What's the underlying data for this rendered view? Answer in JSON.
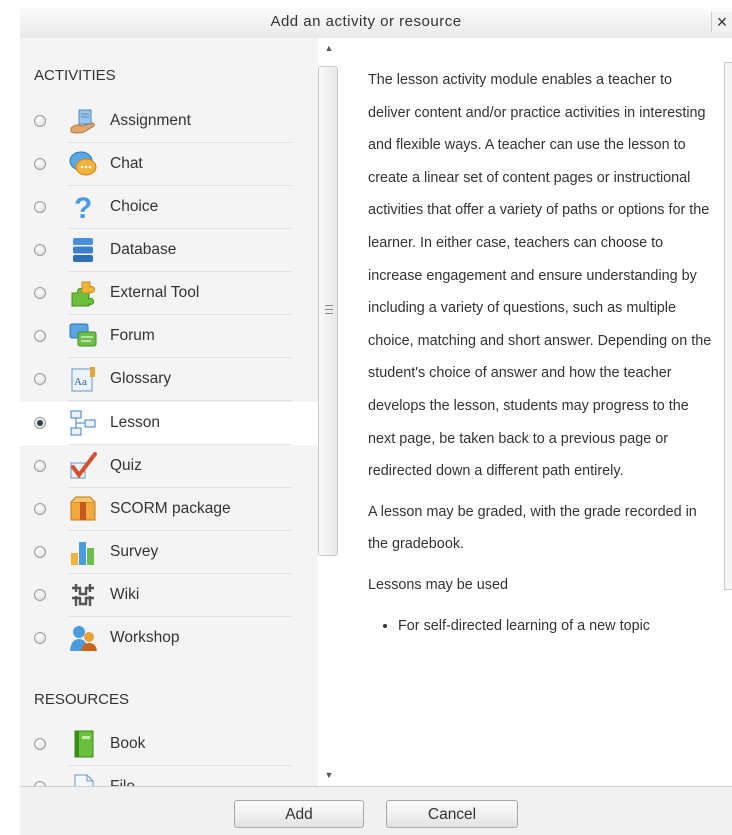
{
  "dialog": {
    "title": "Add an activity or resource",
    "close_label": "×"
  },
  "activities": {
    "heading": "ACTIVITIES",
    "items": [
      {
        "label": "Assignment",
        "icon": "assignment-icon",
        "selected": false
      },
      {
        "label": "Chat",
        "icon": "chat-icon",
        "selected": false
      },
      {
        "label": "Choice",
        "icon": "choice-icon",
        "selected": false
      },
      {
        "label": "Database",
        "icon": "database-icon",
        "selected": false
      },
      {
        "label": "External Tool",
        "icon": "external-tool-icon",
        "selected": false
      },
      {
        "label": "Forum",
        "icon": "forum-icon",
        "selected": false
      },
      {
        "label": "Glossary",
        "icon": "glossary-icon",
        "selected": false
      },
      {
        "label": "Lesson",
        "icon": "lesson-icon",
        "selected": true
      },
      {
        "label": "Quiz",
        "icon": "quiz-icon",
        "selected": false
      },
      {
        "label": "SCORM package",
        "icon": "scorm-icon",
        "selected": false
      },
      {
        "label": "Survey",
        "icon": "survey-icon",
        "selected": false
      },
      {
        "label": "Wiki",
        "icon": "wiki-icon",
        "selected": false
      },
      {
        "label": "Workshop",
        "icon": "workshop-icon",
        "selected": false
      }
    ]
  },
  "resources": {
    "heading": "RESOURCES",
    "items": [
      {
        "label": "Book",
        "icon": "book-icon",
        "selected": false
      },
      {
        "label": "File",
        "icon": "file-icon",
        "selected": false
      }
    ]
  },
  "description": {
    "paragraph1": "The lesson activity module enables a teacher to deliver content and/or practice activities in interesting and flexible ways. A teacher can use the lesson to create a linear set of content pages or instructional activities that offer a variety of paths or options for the learner. In either case, teachers can choose to increase engagement and ensure understanding by including a variety of questions, such as multiple choice, matching and short answer. Depending on the student's choice of answer and how the teacher develops the lesson, students may progress to the next page, be taken back to a previous page or redirected down a different path entirely.",
    "paragraph2": "A lesson may be graded, with the grade recorded in the gradebook.",
    "paragraph3": "Lessons may be used",
    "bullets": [
      "For self-directed learning of a new topic"
    ]
  },
  "footer": {
    "add_label": "Add",
    "cancel_label": "Cancel"
  },
  "colors": {
    "left_pane_bg": "#f4f4f4",
    "selected_row_bg": "#ffffff",
    "text": "#333333"
  }
}
